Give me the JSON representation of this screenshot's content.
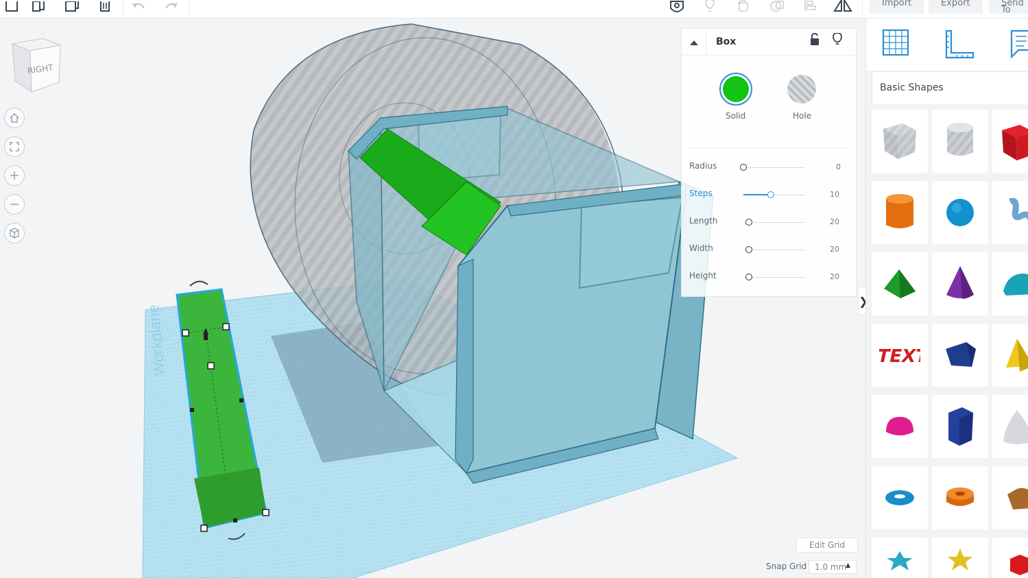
{
  "toolbar": {
    "import_label": "Import",
    "export_label": "Export",
    "send_label": "Send To"
  },
  "view_cube": {
    "face_label": "RIGHT"
  },
  "inspector": {
    "title": "Box",
    "solid_label": "Solid",
    "hole_label": "Hole",
    "solid_color": "#14c314",
    "params": [
      {
        "label": "Radius",
        "value": "0",
        "level": 0.0
      },
      {
        "label": "Steps",
        "value": "10",
        "level": 0.45
      },
      {
        "label": "Length",
        "value": "20",
        "level": 0.0
      },
      {
        "label": "Width",
        "value": "20",
        "level": 0.0
      },
      {
        "label": "Height",
        "value": "20",
        "level": 0.0
      }
    ]
  },
  "library": {
    "category_label": "Basic Shapes"
  },
  "grid": {
    "edit_grid_label": "Edit Grid",
    "snap_label": "Snap Grid",
    "snap_value": "1.0 mm"
  },
  "workplane": {
    "watermark": "Workplane"
  },
  "colors": {
    "accent": "#2b8fd6",
    "workplane": "#a9dcef",
    "selected_shape": "#3cb53c",
    "model": "#8dc8d6"
  }
}
